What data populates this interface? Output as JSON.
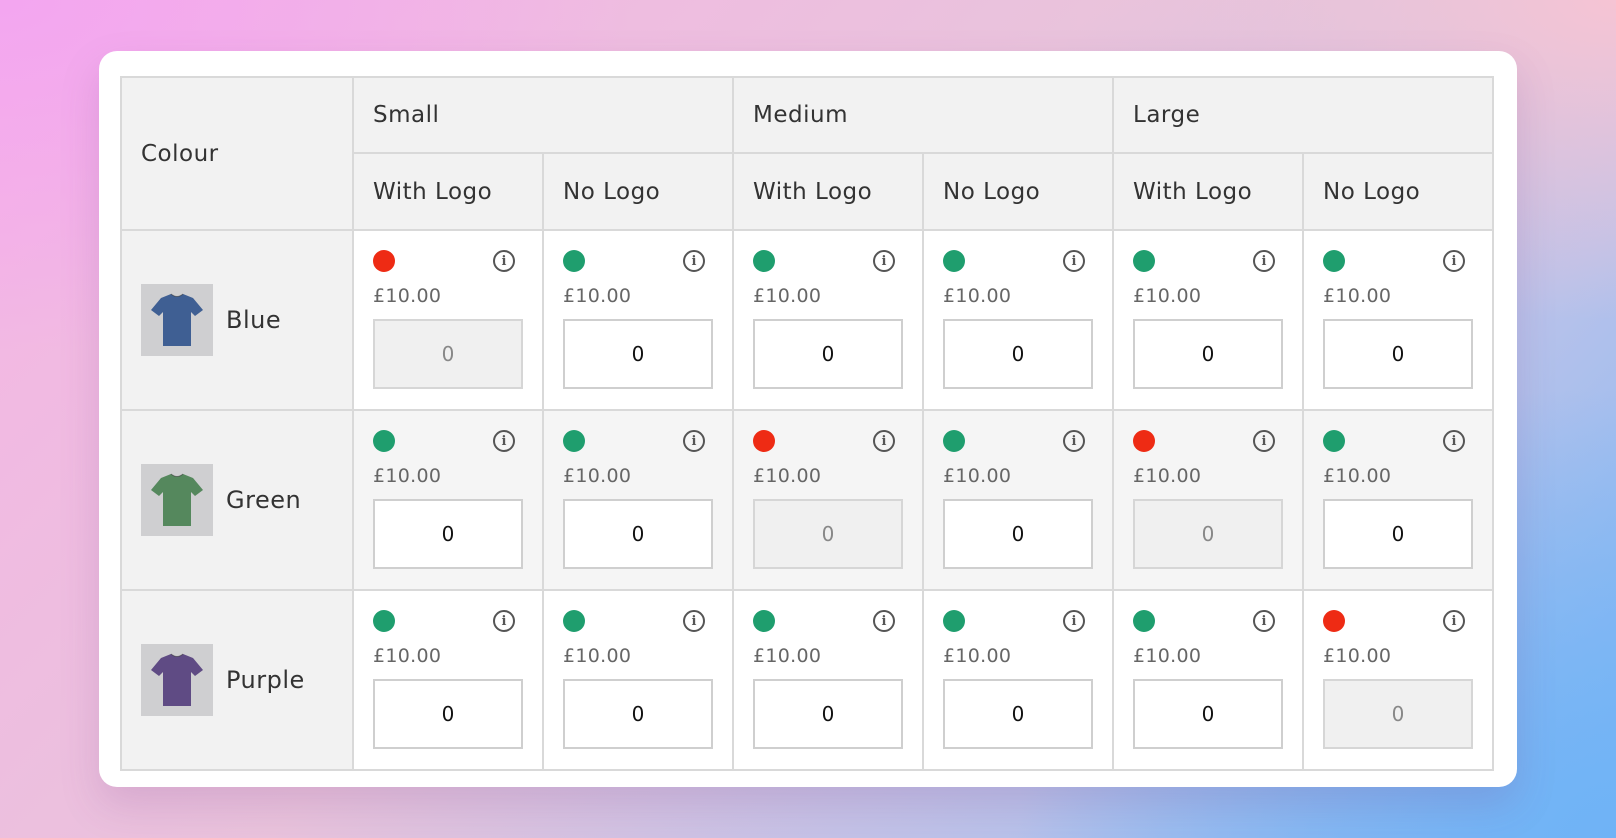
{
  "header": {
    "colour_label": "Colour",
    "sizes": [
      "Small",
      "Medium",
      "Large"
    ],
    "variants": [
      "With Logo",
      "No Logo"
    ]
  },
  "status_colors": {
    "in_stock": "#1f9e6e",
    "out_of_stock": "#ee2b14"
  },
  "rows": [
    {
      "name": "Blue",
      "shirt_color": "#3f5f93",
      "cells": [
        {
          "status": "out_of_stock",
          "price": "£10.00",
          "qty": "0",
          "disabled": true
        },
        {
          "status": "in_stock",
          "price": "£10.00",
          "qty": "0",
          "disabled": false
        },
        {
          "status": "in_stock",
          "price": "£10.00",
          "qty": "0",
          "disabled": false
        },
        {
          "status": "in_stock",
          "price": "£10.00",
          "qty": "0",
          "disabled": false
        },
        {
          "status": "in_stock",
          "price": "£10.00",
          "qty": "0",
          "disabled": false
        },
        {
          "status": "in_stock",
          "price": "£10.00",
          "qty": "0",
          "disabled": false
        }
      ]
    },
    {
      "name": "Green",
      "shirt_color": "#55885d",
      "cells": [
        {
          "status": "in_stock",
          "price": "£10.00",
          "qty": "0",
          "disabled": false
        },
        {
          "status": "in_stock",
          "price": "£10.00",
          "qty": "0",
          "disabled": false
        },
        {
          "status": "out_of_stock",
          "price": "£10.00",
          "qty": "0",
          "disabled": true
        },
        {
          "status": "in_stock",
          "price": "£10.00",
          "qty": "0",
          "disabled": false
        },
        {
          "status": "out_of_stock",
          "price": "£10.00",
          "qty": "0",
          "disabled": true
        },
        {
          "status": "in_stock",
          "price": "£10.00",
          "qty": "0",
          "disabled": false
        }
      ]
    },
    {
      "name": "Purple",
      "shirt_color": "#5f4b84",
      "cells": [
        {
          "status": "in_stock",
          "price": "£10.00",
          "qty": "0",
          "disabled": false
        },
        {
          "status": "in_stock",
          "price": "£10.00",
          "qty": "0",
          "disabled": false
        },
        {
          "status": "in_stock",
          "price": "£10.00",
          "qty": "0",
          "disabled": false
        },
        {
          "status": "in_stock",
          "price": "£10.00",
          "qty": "0",
          "disabled": false
        },
        {
          "status": "in_stock",
          "price": "£10.00",
          "qty": "0",
          "disabled": false
        },
        {
          "status": "out_of_stock",
          "price": "£10.00",
          "qty": "0",
          "disabled": true
        }
      ]
    }
  ]
}
